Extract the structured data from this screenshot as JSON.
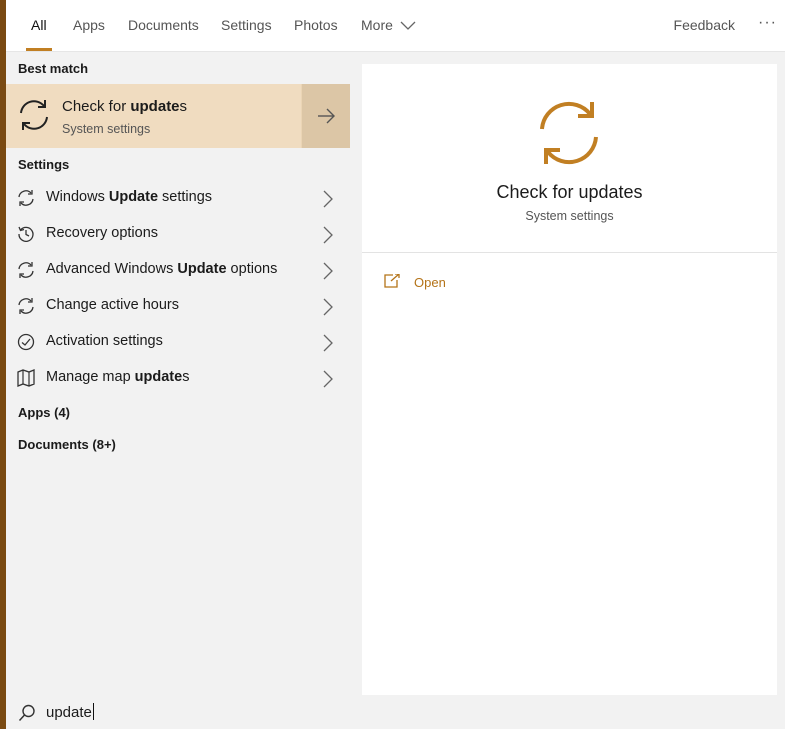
{
  "tabs": [
    {
      "label": "All",
      "active": true
    },
    {
      "label": "Apps"
    },
    {
      "label": "Documents"
    },
    {
      "label": "Settings"
    },
    {
      "label": "Photos"
    },
    {
      "label": "More"
    }
  ],
  "header": {
    "feedback_label": "Feedback",
    "more_options": "···"
  },
  "left": {
    "best_match_heading": "Best match",
    "best_match": {
      "title_pre": "Check for ",
      "title_bold": "update",
      "title_post": "s",
      "subtitle": "System settings",
      "icon": "refresh-icon"
    },
    "settings_heading": "Settings",
    "settings_items": [
      {
        "pre": "Windows ",
        "bold": "Update",
        "post": " settings",
        "icon": "refresh-icon"
      },
      {
        "pre": "Recovery options",
        "bold": "",
        "post": "",
        "icon": "history-icon"
      },
      {
        "pre": "Advanced Windows ",
        "bold": "Update",
        "post": " options",
        "icon": "refresh-icon"
      },
      {
        "pre": "Change active hours",
        "bold": "",
        "post": "",
        "icon": "refresh-icon"
      },
      {
        "pre": "Activation settings",
        "bold": "",
        "post": "",
        "icon": "check-circle-icon"
      },
      {
        "pre": "Manage map ",
        "bold": "update",
        "post": "s",
        "icon": "map-icon"
      }
    ],
    "apps_group": "Apps (4)",
    "documents_group": "Documents (8+)"
  },
  "detail": {
    "title": "Check for updates",
    "subtitle": "System settings",
    "open_label": "Open",
    "icon": "refresh-icon"
  },
  "search": {
    "value": "update",
    "icon": "search-icon"
  },
  "colors": {
    "accent": "#c17f23",
    "accent_dark": "#7a4a12",
    "highlight": "#f0dcc0",
    "link": "#b47318"
  }
}
